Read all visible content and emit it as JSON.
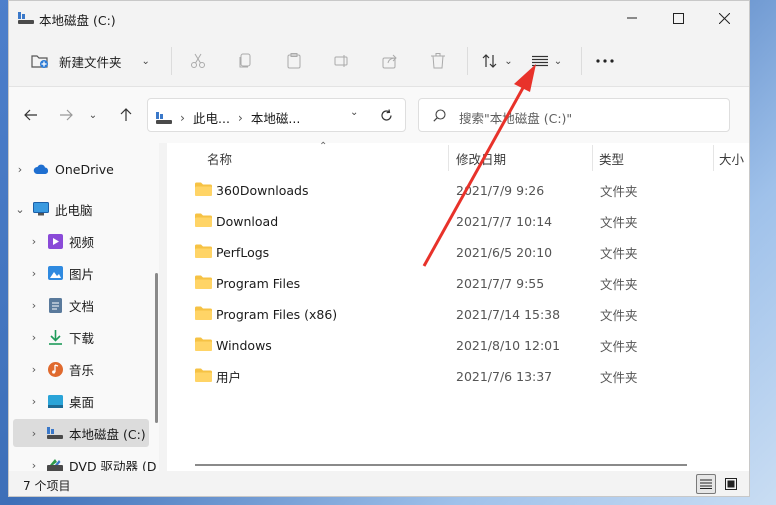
{
  "window": {
    "title": "本地磁盘 (C:)"
  },
  "toolbar": {
    "new_label": "新建文件夹"
  },
  "address": {
    "crumbs": [
      "此电...",
      "本地磁..."
    ],
    "search_placeholder": "搜索\"本地磁盘 (C:)\""
  },
  "sidebar": {
    "items": [
      {
        "label": "OneDrive",
        "icon": "cloud-icon",
        "chevron": "›"
      },
      {
        "label": "此电脑",
        "icon": "computer-icon",
        "chevron": "⌄"
      },
      {
        "label": "视频",
        "icon": "video-icon",
        "chevron": "›"
      },
      {
        "label": "图片",
        "icon": "picture-icon",
        "chevron": "›"
      },
      {
        "label": "文档",
        "icon": "document-icon",
        "chevron": "›"
      },
      {
        "label": "下载",
        "icon": "download-icon",
        "chevron": "›"
      },
      {
        "label": "音乐",
        "icon": "music-icon",
        "chevron": "›"
      },
      {
        "label": "桌面",
        "icon": "desktop-icon",
        "chevron": "›"
      },
      {
        "label": "本地磁盘 (C:)",
        "icon": "drive-icon",
        "chevron": "›"
      },
      {
        "label": "DVD 驱动器 (D",
        "icon": "dvd-icon",
        "chevron": "›"
      }
    ]
  },
  "columns": {
    "name": "名称",
    "date": "修改日期",
    "type": "类型",
    "size": "大小"
  },
  "files": [
    {
      "name": "360Downloads",
      "date": "2021/7/9 9:26",
      "type": "文件夹"
    },
    {
      "name": "Download",
      "date": "2021/7/7 10:14",
      "type": "文件夹"
    },
    {
      "name": "PerfLogs",
      "date": "2021/6/5 20:10",
      "type": "文件夹"
    },
    {
      "name": "Program Files",
      "date": "2021/7/7 9:55",
      "type": "文件夹"
    },
    {
      "name": "Program Files (x86)",
      "date": "2021/7/14 15:38",
      "type": "文件夹"
    },
    {
      "name": "Windows",
      "date": "2021/8/10 12:01",
      "type": "文件夹"
    },
    {
      "name": "用户",
      "date": "2021/7/6 13:37",
      "type": "文件夹"
    }
  ],
  "status": {
    "count": "7 个项目"
  },
  "colors": {
    "folder": "#f6c244",
    "annotation_arrow": "#e8322a",
    "selected_bg": "#dcdcdc"
  }
}
